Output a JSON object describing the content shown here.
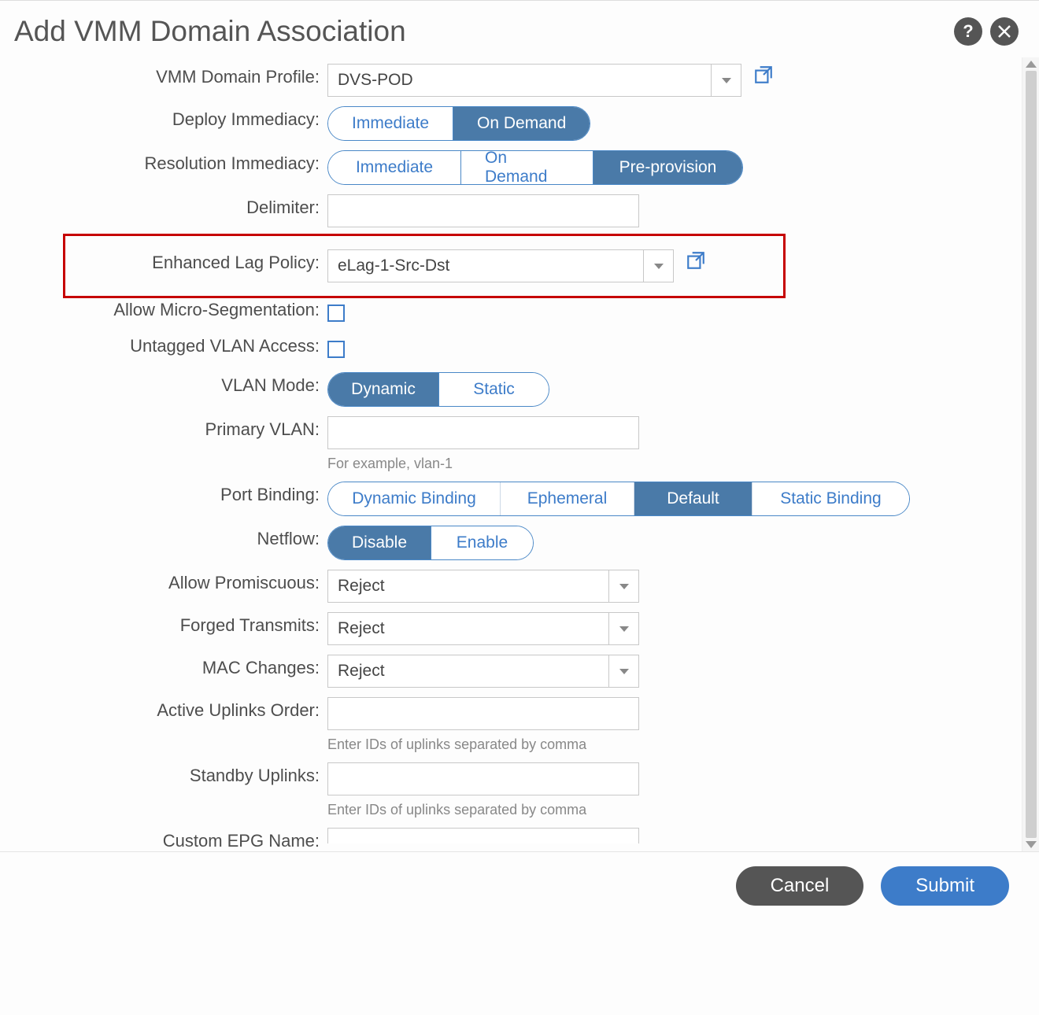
{
  "dialog": {
    "title": "Add VMM Domain Association",
    "help_icon": "?",
    "close_icon": "×"
  },
  "fields": {
    "domain_profile": {
      "label": "VMM Domain Profile:",
      "value": "DVS-POD"
    },
    "deploy_immediacy": {
      "label": "Deploy Immediacy:",
      "options": [
        "Immediate",
        "On Demand"
      ],
      "selected": "On Demand"
    },
    "resolution_immediacy": {
      "label": "Resolution Immediacy:",
      "options": [
        "Immediate",
        "On Demand",
        "Pre-provision"
      ],
      "selected": "Pre-provision"
    },
    "delimiter": {
      "label": "Delimiter:",
      "value": ""
    },
    "enhanced_lag": {
      "label": "Enhanced Lag Policy:",
      "value": "eLag-1-Src-Dst"
    },
    "allow_micro": {
      "label": "Allow Micro-Segmentation:",
      "checked": false
    },
    "untagged_vlan": {
      "label": "Untagged VLAN Access:",
      "checked": false
    },
    "vlan_mode": {
      "label": "VLAN Mode:",
      "options": [
        "Dynamic",
        "Static"
      ],
      "selected": "Dynamic"
    },
    "primary_vlan": {
      "label": "Primary VLAN:",
      "value": "",
      "hint": "For example, vlan-1"
    },
    "port_binding": {
      "label": "Port Binding:",
      "options": [
        "Dynamic Binding",
        "Ephemeral",
        "Default",
        "Static Binding"
      ],
      "selected": "Default"
    },
    "netflow": {
      "label": "Netflow:",
      "options": [
        "Disable",
        "Enable"
      ],
      "selected": "Disable"
    },
    "allow_promiscuous": {
      "label": "Allow Promiscuous:",
      "value": "Reject"
    },
    "forged_transmits": {
      "label": "Forged Transmits:",
      "value": "Reject"
    },
    "mac_changes": {
      "label": "MAC Changes:",
      "value": "Reject"
    },
    "active_uplinks": {
      "label": "Active Uplinks Order:",
      "value": "",
      "hint": "Enter IDs of uplinks separated by comma"
    },
    "standby_uplinks": {
      "label": "Standby Uplinks:",
      "value": "",
      "hint": "Enter IDs of uplinks separated by comma"
    },
    "custom_epg": {
      "label": "Custom EPG Name:",
      "value": ""
    }
  },
  "footer": {
    "cancel": "Cancel",
    "submit": "Submit"
  }
}
